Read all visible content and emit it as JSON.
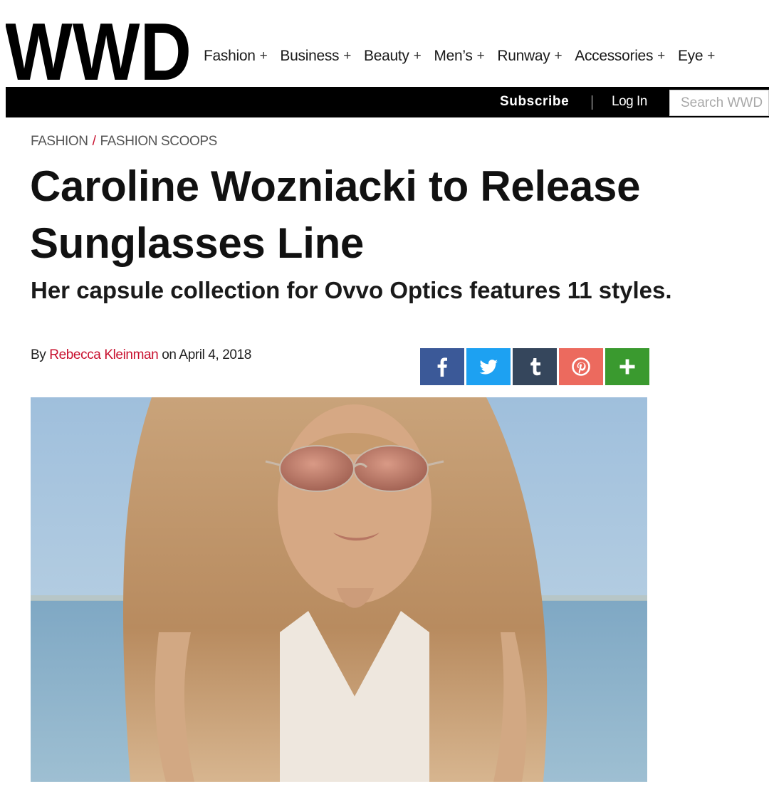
{
  "site": {
    "logo_text": "WWD"
  },
  "nav": {
    "items": [
      {
        "label": "Fashion",
        "expand": "+"
      },
      {
        "label": "Business",
        "expand": "+"
      },
      {
        "label": "Beauty",
        "expand": "+"
      },
      {
        "label": "Men’s",
        "expand": "+"
      },
      {
        "label": "Runway",
        "expand": "+"
      },
      {
        "label": "Accessories",
        "expand": "+"
      },
      {
        "label": "Eye",
        "expand": "+"
      }
    ]
  },
  "account": {
    "subscribe_label": "Subscribe",
    "login_label": "Log In",
    "search_placeholder": "Search WWD"
  },
  "article": {
    "breadcrumb": [
      "FASHION",
      "FASHION SCOOPS"
    ],
    "breadcrumb_separator": "/",
    "headline": "Caroline Wozniacki to Release Sunglasses Line",
    "dek": "Her capsule collection for Ovvo Optics features 11 styles.",
    "byline_prefix": "By",
    "author": "Rebecca Kleinman",
    "date_prefix": "on",
    "date": "April 4, 2018"
  },
  "share": {
    "buttons": [
      {
        "icon": "facebook-icon",
        "color": "#3b5998"
      },
      {
        "icon": "twitter-icon",
        "color": "#1da1f2"
      },
      {
        "icon": "tumblr-icon",
        "color": "#35465c"
      },
      {
        "icon": "pinterest-icon",
        "color": "#ec6a5e"
      },
      {
        "icon": "plus-icon",
        "color": "#3a9a2f"
      }
    ]
  },
  "colors": {
    "accent_red": "#c8102e",
    "bar_black": "#000000"
  }
}
